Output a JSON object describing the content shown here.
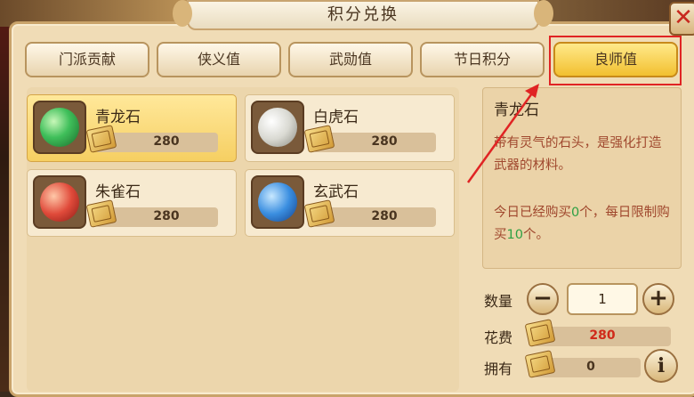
{
  "window": {
    "title": "积分兑换",
    "close_symbol": "✕"
  },
  "tabs": [
    {
      "label": "门派贡献",
      "active": false
    },
    {
      "label": "侠义值",
      "active": false
    },
    {
      "label": "武勋值",
      "active": false
    },
    {
      "label": "节日积分",
      "active": false
    },
    {
      "label": "良师值",
      "active": true
    }
  ],
  "items": [
    {
      "name": "青龙石",
      "price": "280",
      "icon": "green-dragon-stone-icon",
      "color": "#3fbf5a",
      "selected": true
    },
    {
      "name": "白虎石",
      "price": "280",
      "icon": "white-tiger-stone-icon",
      "color": "#d9d9d2",
      "selected": false
    },
    {
      "name": "朱雀石",
      "price": "280",
      "icon": "vermilion-bird-stone-icon",
      "color": "#e04a3a",
      "selected": false
    },
    {
      "name": "玄武石",
      "price": "280",
      "icon": "black-tortoise-stone-icon",
      "color": "#3a8ee0",
      "selected": false
    }
  ],
  "detail": {
    "title": "青龙石",
    "description": "带有灵气的石头，是强化打造武器的材料。",
    "limit_prefix": "今日已经购买",
    "bought": "0",
    "limit_mid": "个，每日限制购买",
    "max": "10",
    "limit_suffix": "个。"
  },
  "purchase": {
    "qty_label": "数量",
    "qty_value": "1",
    "minus": "−",
    "plus": "+",
    "cost_label": "花费",
    "cost_value": "280",
    "own_label": "拥有",
    "own_value": "0",
    "info": "i"
  },
  "colors": {
    "accent_gold": "#f2c030",
    "highlight_red": "#e02424",
    "cost_red": "#d02a1a"
  }
}
